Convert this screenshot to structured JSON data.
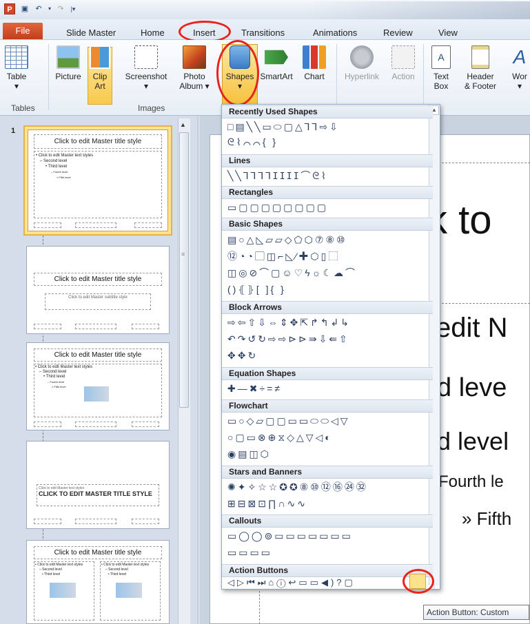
{
  "app": {
    "logo_letter": "P",
    "quick_access": [
      "save-icon",
      "undo-icon",
      "redo-icon"
    ]
  },
  "tabs": {
    "file": "File",
    "items": [
      "Slide Master",
      "Home",
      "Insert",
      "Transitions",
      "Animations",
      "Review",
      "View"
    ]
  },
  "ribbon": {
    "buttons": [
      {
        "label": "Table",
        "sub": "▾"
      },
      {
        "label": "Picture",
        "sub": ""
      },
      {
        "label": "Clip",
        "sub": "Art"
      },
      {
        "label": "Screenshot",
        "sub": "▾"
      },
      {
        "label": "Photo",
        "sub": "Album ▾"
      },
      {
        "label": "Shapes",
        "sub": "▾"
      },
      {
        "label": "SmartArt",
        "sub": ""
      },
      {
        "label": "Chart",
        "sub": ""
      },
      {
        "label": "Hyperlink",
        "sub": ""
      },
      {
        "label": "Action",
        "sub": ""
      },
      {
        "label": "Text",
        "sub": "Box"
      },
      {
        "label": "Header",
        "sub": "& Footer"
      },
      {
        "label": "Wor",
        "sub": "▾"
      }
    ],
    "groups": [
      "Tables",
      "Images"
    ]
  },
  "thumbnails": {
    "slide_number": "1",
    "t1_title": "Click to edit Master title style",
    "t1_l1": "• Click to edit Master text styles",
    "t1_l2": "– Second level",
    "t1_l3": "• Third level",
    "t1_l4": "– Fourth level",
    "t1_l5": "» Fifth level",
    "t2_title": "Click to edit Master title style",
    "t2_sub": "Click to edit Master subtitle style",
    "t3_title": "Click to edit Master title style",
    "t3_l1": "• Click to edit Master text styles",
    "t3_l2": "– Second level",
    "t3_l3": "• Third level",
    "t3_l4": "– Fourth level",
    "t3_l5": "» Fifth level",
    "t4_small": "Click to edit Master text styles",
    "t4_title": "CLICK TO EDIT MASTER TITLE STYLE",
    "t5_title": "Click to edit Master title style",
    "t5_l1": "• Click to edit Master text styles",
    "t5_l2": "– Second level",
    "t5_l3": "• Third level"
  },
  "slide": {
    "title": "k to",
    "l1": "edit N",
    "l2": "d leve",
    "l3": "d level",
    "l4": "Fourth le",
    "l5": "» Fifth"
  },
  "dropdown": {
    "sections": [
      {
        "label": "Recently Used Shapes",
        "rows": [
          "□▤╲╲▭⬭▢△⅂⅂⇨⇩",
          "ᘓ⌇⌒⌒{ }"
        ]
      },
      {
        "label": "Lines",
        "rows": [
          "╲╲⅂⅂⅂⅂ⵊⵊⵊⵊ⌒ᘓ⌇"
        ]
      },
      {
        "label": "Rectangles",
        "rows": [
          "▭▢▢▢▢▢▢▢▢"
        ]
      },
      {
        "label": "Basic Shapes",
        "rows": [
          "▤○△◺▱▱◇⬠⬡⑦⑧⑩",
          "⑫◔◔▢◫⌐◺∕✚⬡▯⬚",
          "◫◎⊘⌒▢☺♡ϟ☼☾☁⌒",
          "()⦃⦄[ ]{ }"
        ]
      },
      {
        "label": "Block Arrows",
        "rows": [
          "⇨⇦⇧⇩⇔⇕✥⇱↱↰↲↳",
          "↶↷↺↻⇨⇨⊳⊳⇛⇩⇚⇧",
          "✥✥↻"
        ]
      },
      {
        "label": "Equation Shapes",
        "rows": [
          "✚—✖÷=≠"
        ]
      },
      {
        "label": "Flowchart",
        "rows": [
          "▭○◇▱▢▢▭▭⬭⬭◁▽",
          "○▢▭⊗⊕⧖◇△▽◁◐",
          "◉▤◫⬡"
        ]
      },
      {
        "label": "Stars and Banners",
        "rows": [
          "✺✦✧☆☆✪✪⑧⑩⑫⑯㉔㉜",
          "⊞⊟⊠⊡∏∩∿∿"
        ]
      },
      {
        "label": "Callouts",
        "rows": [
          "▭◯◯⊚▭▭▭▭▭▭▭",
          "▭▭▭▭"
        ]
      },
      {
        "label": "Action Buttons",
        "rows": [
          "◁▷⏮⏭⌂ⓘ↩▭▭◀)?▢"
        ]
      }
    ]
  },
  "tooltip": "Action Button: Custom"
}
